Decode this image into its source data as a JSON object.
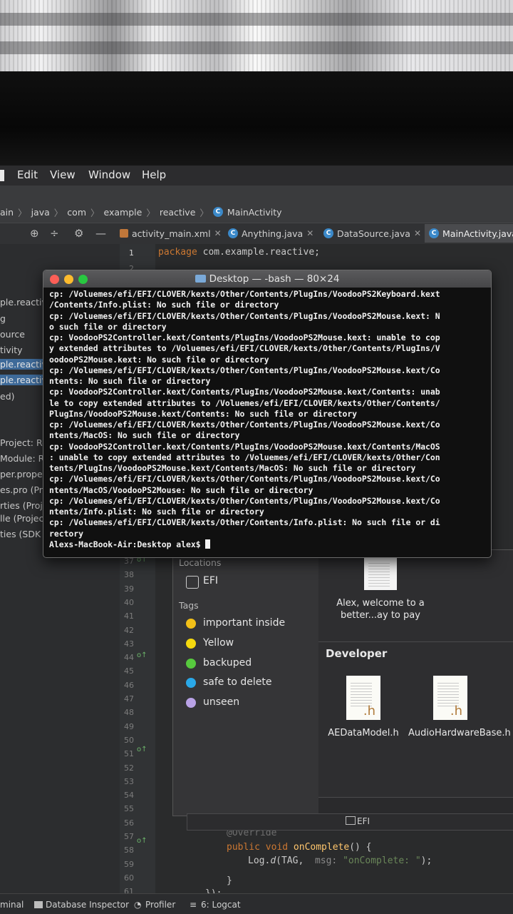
{
  "menubar": {
    "items": [
      "Edit",
      "View",
      "Window",
      "Help"
    ]
  },
  "breadcrumb": {
    "items": [
      "ain",
      "java",
      "com",
      "example",
      "reactive",
      "MainActivity"
    ]
  },
  "tabs": [
    {
      "label": "activity_main.xml",
      "icon": "xml-file-icon"
    },
    {
      "label": "Anything.java",
      "icon": "class-icon"
    },
    {
      "label": "DataSource.java",
      "icon": "class-icon"
    },
    {
      "label": "MainActivity.java",
      "icon": "class-icon",
      "active": true
    }
  ],
  "project_panel": {
    "items": [
      "ple.reactiv",
      "g",
      "ource",
      "tivity",
      "ple.reactiv",
      "ple.reactiv",
      "ed)",
      "Project: Re",
      "Module: Re",
      "per.propert",
      "es.pro (Pro",
      "rties (Proje",
      "lle (Project",
      "ties (SDK Lo"
    ]
  },
  "editor": {
    "line_numbers": [
      "1",
      "2",
      "37",
      "38",
      "39",
      "40",
      "41",
      "42",
      "43",
      "44",
      "45",
      "46",
      "47",
      "48",
      "49",
      "50",
      "51",
      "52",
      "53",
      "54",
      "55",
      "56",
      "57",
      "58",
      "59",
      "60",
      "61",
      "62"
    ],
    "code_line_1_keyword": "package",
    "code_line_1_rest": " com.example.reactive;",
    "code_override": "@Override",
    "code_public": "public void ",
    "code_on_complete": "onComplete",
    "code_on_complete_rest": "() {",
    "code_log": "Log.",
    "code_log_d": "d",
    "code_log_tag": "(TAG,  ",
    "code_log_hint": "msg: ",
    "code_log_str": "\"onComplete: \"",
    "code_log_end": ");",
    "code_close_brace": "}",
    "code_close_paren": "});"
  },
  "terminal": {
    "title": "Desktop — -bash — 80×24",
    "lines": [
      "cp: /Voluemes/efi/EFI/CLOVER/kexts/Other/Contents/PlugIns/VoodooPS2Keyboard.kext",
      "/Contents/Info.plist: No such file or directory",
      "cp: /Voluemes/efi/EFI/CLOVER/kexts/Other/Contents/PlugIns/VoodooPS2Mouse.kext: N",
      "o such file or directory",
      "cp: VoodooPS2Controller.kext/Contents/PlugIns/VoodooPS2Mouse.kext: unable to cop",
      "y extended attributes to /Voluemes/efi/EFI/CLOVER/kexts/Other/Contents/PlugIns/V",
      "oodooPS2Mouse.kext: No such file or directory",
      "cp: /Voluemes/efi/EFI/CLOVER/kexts/Other/Contents/PlugIns/VoodooPS2Mouse.kext/Co",
      "ntents: No such file or directory",
      "cp: VoodooPS2Controller.kext/Contents/PlugIns/VoodooPS2Mouse.kext/Contents: unab",
      "le to copy extended attributes to /Voluemes/efi/EFI/CLOVER/kexts/Other/Contents/",
      "PlugIns/VoodooPS2Mouse.kext/Contents: No such file or directory",
      "cp: /Voluemes/efi/EFI/CLOVER/kexts/Other/Contents/PlugIns/VoodooPS2Mouse.kext/Co",
      "ntents/MacOS: No such file or directory",
      "cp: VoodooPS2Controller.kext/Contents/PlugIns/VoodooPS2Mouse.kext/Contents/MacOS",
      ": unable to copy extended attributes to /Voluemes/efi/EFI/CLOVER/kexts/Other/Con",
      "tents/PlugIns/VoodooPS2Mouse.kext/Contents/MacOS: No such file or directory",
      "cp: /Voluemes/efi/EFI/CLOVER/kexts/Other/Contents/PlugIns/VoodooPS2Mouse.kext/Co",
      "ntents/MacOS/VoodooPS2Mouse: No such file or directory",
      "cp: /Voluemes/efi/EFI/CLOVER/kexts/Other/Contents/PlugIns/VoodooPS2Mouse.kext/Co",
      "ntents/Info.plist: No such file or directory",
      "cp: /Voluemes/efi/EFI/CLOVER/kexts/Other/Contents/Info.plist: No such file or di",
      "rectory"
    ],
    "prompt": "Alexs-MacBook-Air:Desktop alex$ "
  },
  "finder": {
    "locations_header": "Locations",
    "locations": [
      {
        "label": "EFI",
        "icon": "drive-icon"
      }
    ],
    "tags_header": "Tags",
    "tags": [
      {
        "label": "important inside",
        "color": "#f2c018"
      },
      {
        "label": "Yellow",
        "color": "#f5d90f"
      },
      {
        "label": "backuped",
        "color": "#57c93e"
      },
      {
        "label": "safe to delete",
        "color": "#2aa8e8"
      },
      {
        "label": "unseen",
        "color": "#b9a2e6"
      }
    ],
    "recent_file_label": "Alex, welcome to a better...ay to pay",
    "section_developer": "Developer",
    "files": [
      {
        "name": "AEDataModel.h",
        "ext": ".h"
      },
      {
        "name": "AudioHardwareBase.h",
        "ext": ".h"
      }
    ],
    "pathbar_label": "EFI"
  },
  "bottombar": {
    "items": [
      "minal",
      "Database Inspector",
      "Profiler",
      "6: Logcat"
    ]
  }
}
